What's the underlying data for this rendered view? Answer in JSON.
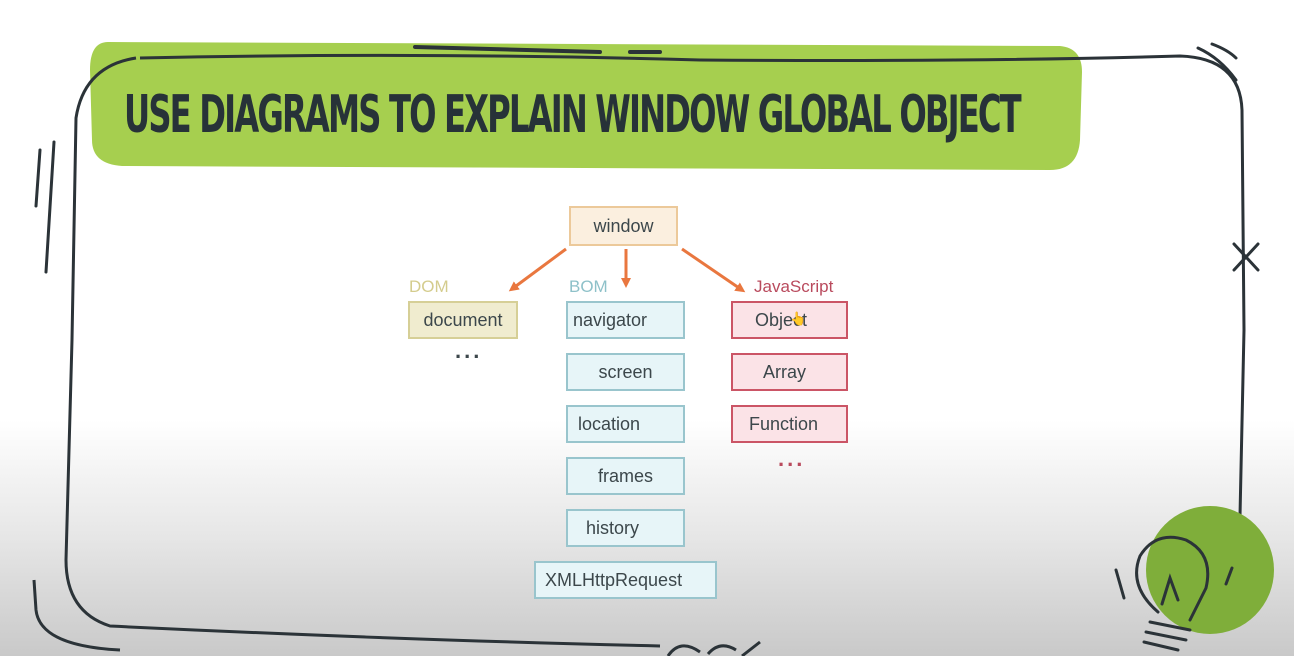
{
  "title": "Use diagrams to explain window global object",
  "diagram": {
    "root": "window",
    "groups": {
      "dom": {
        "label": "DOM",
        "items": [
          "document"
        ],
        "more": "..."
      },
      "bom": {
        "label": "BOM",
        "items": [
          "navigator",
          "screen",
          "location",
          "frames",
          "history",
          "XMLHttpRequest"
        ]
      },
      "js": {
        "label": "JavaScript",
        "items": [
          "Object",
          "Array",
          "Function"
        ],
        "more": "..."
      }
    }
  },
  "colors": {
    "title_banner": "#a6cf4f",
    "arrow": "#e9773f",
    "dom_label": "#d4cc8d",
    "bom_label": "#8ec1c9",
    "js_label": "#b94a5d",
    "frame": "#2b3338"
  }
}
